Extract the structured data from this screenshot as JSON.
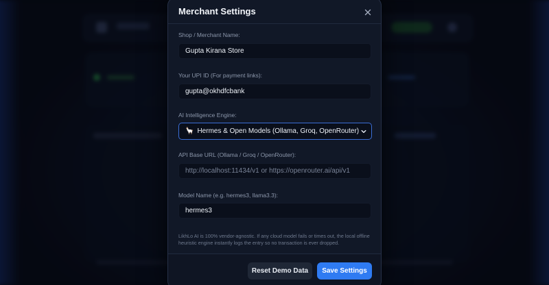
{
  "modal": {
    "title": "Merchant Settings",
    "close_icon": "close-icon"
  },
  "fields": {
    "shop_name": {
      "label": "Shop / Merchant Name:",
      "value": "Gupta Kirana Store"
    },
    "upi_id": {
      "label": "Your UPI ID (For payment links):",
      "value": "gupta@okhdfcbank"
    },
    "ai_engine": {
      "label": "AI Intelligence Engine:",
      "icon": "🦙",
      "selected": "Hermes & Open Models (Ollama, Groq, OpenRouter)"
    },
    "api_base_url": {
      "label": "API Base URL (Ollama / Groq / OpenRouter):",
      "value": "",
      "placeholder": "http://localhost:11434/v1 or https://openrouter.ai/api/v1"
    },
    "model_name": {
      "label": "Model Name (e.g. hermes3, llama3.3):",
      "value": "hermes3"
    }
  },
  "note": "LikhLo AI is 100% vendor-agnostic. If any cloud model fails or times out, the local offline heuristic engine instantly logs the entry so no transaction is ever dropped.",
  "footer": {
    "reset_label": "Reset Demo Data",
    "save_label": "Save Settings"
  },
  "colors": {
    "accent": "#2f7bf2",
    "select_border": "#3b6fd8",
    "modal_bg": "#111827"
  }
}
